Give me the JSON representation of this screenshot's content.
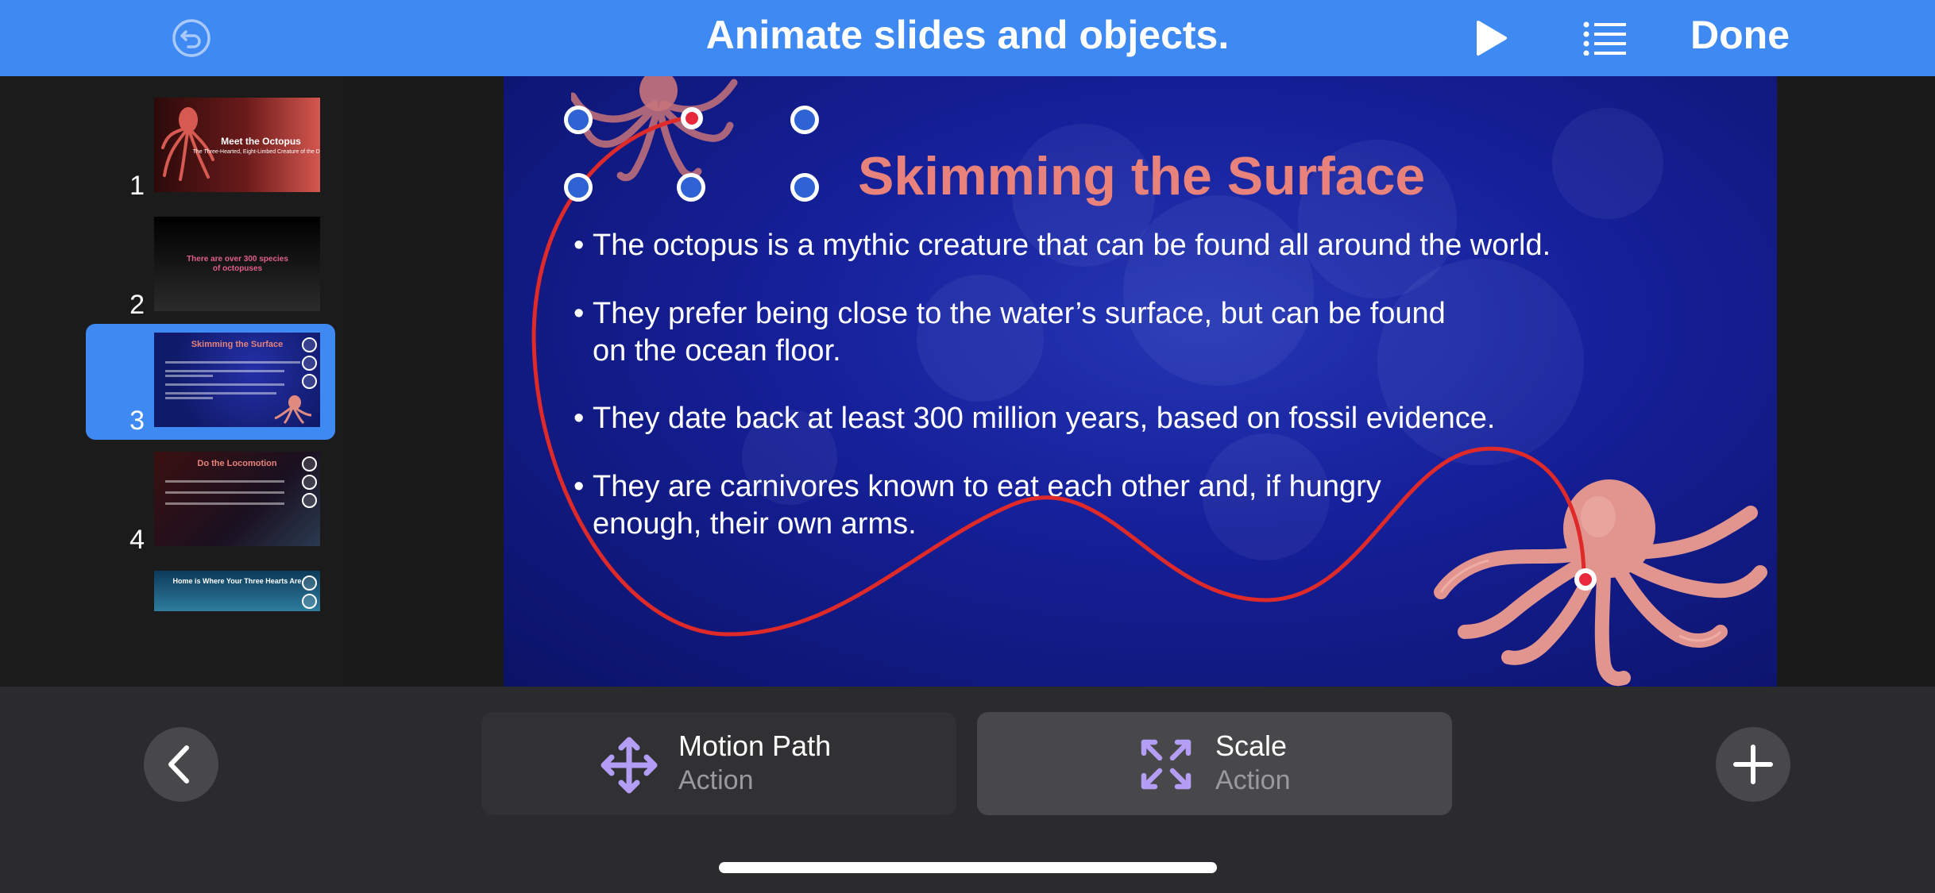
{
  "toolbar": {
    "title": "Animate slides and objects.",
    "done_label": "Done",
    "undo_icon": "undo-icon",
    "play_icon": "play-icon",
    "outline_icon": "list-icon"
  },
  "sidebar": {
    "slides": [
      {
        "number": "1",
        "title": "Meet the Octopus",
        "subtitle": "The Three-Hearted, Eight-Limbed Creature of the Deep"
      },
      {
        "number": "2",
        "title": "There are over 300 species of octopuses"
      },
      {
        "number": "3",
        "title": "Skimming the Surface",
        "selected": true
      },
      {
        "number": "4",
        "title": "Do the Locomotion"
      },
      {
        "number": "",
        "title": "Home is Where Your Three Hearts Are"
      }
    ],
    "add_slide_icon": "plus-icon"
  },
  "slide": {
    "title": "Skimming the Surface",
    "bullets": [
      {
        "line1": "The octopus is a mythic creature that can be found all around the world.",
        "line2": ""
      },
      {
        "line1": "They prefer being close to the water’s surface, but can be found",
        "line2": "on the ocean floor."
      },
      {
        "line1": "They date back at least 300 million years, based on fossil evidence.",
        "line2": ""
      },
      {
        "line1": "They are carnivores known to eat each other and, if hungry",
        "line2": "enough, their own arms."
      }
    ],
    "bullet_char": "•"
  },
  "actions": {
    "back_icon": "chevron-left-icon",
    "add_icon": "plus-icon",
    "cards": [
      {
        "title": "Motion Path",
        "subtitle": "Action",
        "icon": "move-arrows-icon",
        "active": false
      },
      {
        "title": "Scale",
        "subtitle": "Action",
        "icon": "expand-arrows-icon",
        "active": true
      }
    ]
  },
  "colors": {
    "accent": "#3f8af2",
    "path_red": "#e02a2a",
    "title_coral": "#e8827a",
    "icon_purple": "#b39df5"
  }
}
